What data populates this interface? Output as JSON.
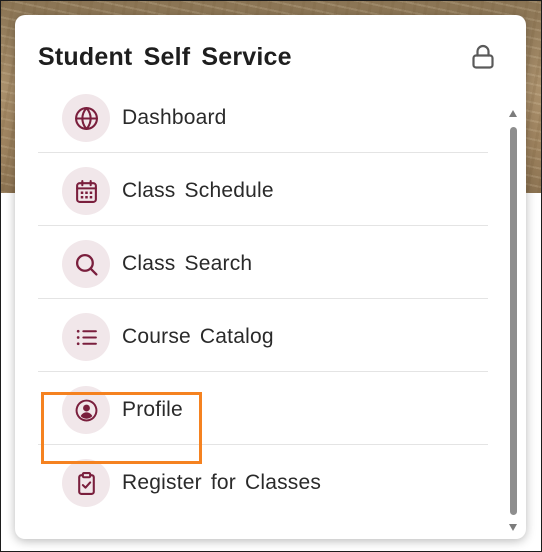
{
  "card": {
    "title": "Student Self Service"
  },
  "icons": {
    "lock": "lock-icon"
  },
  "colors": {
    "icon_color": "#7a1f3d",
    "icon_bg": "#f1e7ea",
    "highlight": "#f58220",
    "title_text": "#1e1e1e"
  },
  "menu": {
    "items": [
      {
        "label": "Dashboard",
        "icon": "globe-icon"
      },
      {
        "label": "Class Schedule",
        "icon": "calendar-icon"
      },
      {
        "label": "Class Search",
        "icon": "search-icon"
      },
      {
        "label": "Course Catalog",
        "icon": "list-icon"
      },
      {
        "label": "Profile",
        "icon": "user-circle-icon"
      },
      {
        "label": "Register for Classes",
        "icon": "clipboard-check-icon"
      }
    ]
  }
}
